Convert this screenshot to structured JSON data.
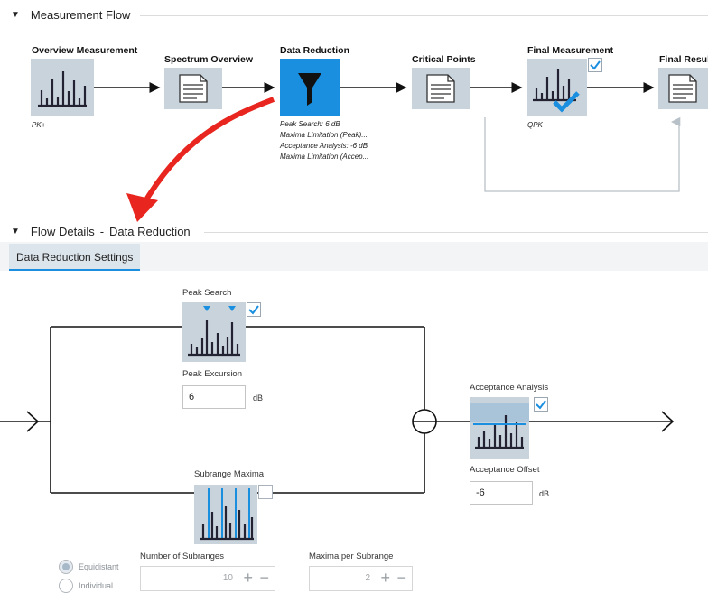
{
  "measurement_flow": {
    "title": "Measurement Flow",
    "nodes": {
      "overview": {
        "title": "Overview Measurement",
        "info": "PK+"
      },
      "spectrum": {
        "title": "Spectrum Overview"
      },
      "reduction": {
        "title": "Data Reduction",
        "info": [
          "Peak Search: 6 dB",
          "Maxima Limitation (Peak)...",
          "Acceptance Analysis: -6 dB",
          "Maxima Limitation (Accep..."
        ]
      },
      "critical": {
        "title": "Critical Points"
      },
      "final": {
        "title": "Final Measurement",
        "info": "QPK",
        "checked": true
      },
      "results": {
        "title": "Final Results"
      }
    }
  },
  "flow_details": {
    "title": "Flow Details",
    "separator": "-",
    "subject": "Data Reduction"
  },
  "tabs": [
    {
      "label": "Data Reduction Settings",
      "active": true
    }
  ],
  "settings": {
    "peak_search": {
      "label": "Peak Search",
      "checked": true
    },
    "peak_excursion": {
      "label": "Peak Excursion",
      "value": "6",
      "unit": "dB"
    },
    "acceptance_analysis": {
      "label": "Acceptance Analysis",
      "checked": true
    },
    "acceptance_offset": {
      "label": "Acceptance Offset",
      "value": "-6",
      "unit": "dB"
    },
    "subrange_maxima": {
      "label": "Subrange Maxima",
      "checked": false
    },
    "mode_options": [
      {
        "label": "Equidistant",
        "selected": true
      },
      {
        "label": "Individual",
        "selected": false
      }
    ],
    "number_of_subranges": {
      "label": "Number of Subranges",
      "value": "10"
    },
    "maxima_per_subrange": {
      "label": "Maxima per Subrange",
      "value": "2"
    }
  },
  "colors": {
    "accent": "#1a8fe0",
    "tile": "#c9d3dc",
    "arrow_red": "#e8251e"
  }
}
